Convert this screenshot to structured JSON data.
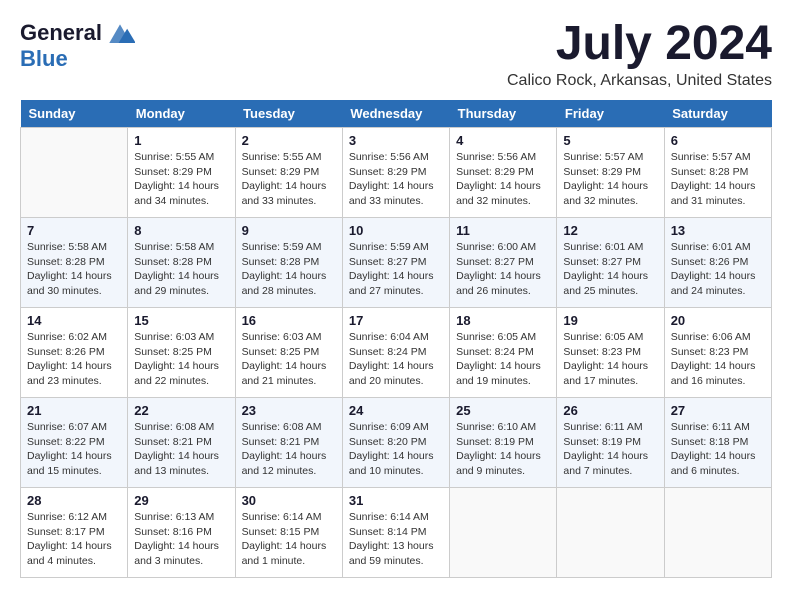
{
  "logo": {
    "general": "General",
    "blue": "Blue"
  },
  "title": "July 2024",
  "location": "Calico Rock, Arkansas, United States",
  "days_of_week": [
    "Sunday",
    "Monday",
    "Tuesday",
    "Wednesday",
    "Thursday",
    "Friday",
    "Saturday"
  ],
  "weeks": [
    [
      {
        "day": null
      },
      {
        "day": 1,
        "sunrise": "5:55 AM",
        "sunset": "8:29 PM",
        "daylight": "14 hours and 34 minutes."
      },
      {
        "day": 2,
        "sunrise": "5:55 AM",
        "sunset": "8:29 PM",
        "daylight": "14 hours and 33 minutes."
      },
      {
        "day": 3,
        "sunrise": "5:56 AM",
        "sunset": "8:29 PM",
        "daylight": "14 hours and 33 minutes."
      },
      {
        "day": 4,
        "sunrise": "5:56 AM",
        "sunset": "8:29 PM",
        "daylight": "14 hours and 32 minutes."
      },
      {
        "day": 5,
        "sunrise": "5:57 AM",
        "sunset": "8:29 PM",
        "daylight": "14 hours and 32 minutes."
      },
      {
        "day": 6,
        "sunrise": "5:57 AM",
        "sunset": "8:28 PM",
        "daylight": "14 hours and 31 minutes."
      }
    ],
    [
      {
        "day": 7,
        "sunrise": "5:58 AM",
        "sunset": "8:28 PM",
        "daylight": "14 hours and 30 minutes."
      },
      {
        "day": 8,
        "sunrise": "5:58 AM",
        "sunset": "8:28 PM",
        "daylight": "14 hours and 29 minutes."
      },
      {
        "day": 9,
        "sunrise": "5:59 AM",
        "sunset": "8:28 PM",
        "daylight": "14 hours and 28 minutes."
      },
      {
        "day": 10,
        "sunrise": "5:59 AM",
        "sunset": "8:27 PM",
        "daylight": "14 hours and 27 minutes."
      },
      {
        "day": 11,
        "sunrise": "6:00 AM",
        "sunset": "8:27 PM",
        "daylight": "14 hours and 26 minutes."
      },
      {
        "day": 12,
        "sunrise": "6:01 AM",
        "sunset": "8:27 PM",
        "daylight": "14 hours and 25 minutes."
      },
      {
        "day": 13,
        "sunrise": "6:01 AM",
        "sunset": "8:26 PM",
        "daylight": "14 hours and 24 minutes."
      }
    ],
    [
      {
        "day": 14,
        "sunrise": "6:02 AM",
        "sunset": "8:26 PM",
        "daylight": "14 hours and 23 minutes."
      },
      {
        "day": 15,
        "sunrise": "6:03 AM",
        "sunset": "8:25 PM",
        "daylight": "14 hours and 22 minutes."
      },
      {
        "day": 16,
        "sunrise": "6:03 AM",
        "sunset": "8:25 PM",
        "daylight": "14 hours and 21 minutes."
      },
      {
        "day": 17,
        "sunrise": "6:04 AM",
        "sunset": "8:24 PM",
        "daylight": "14 hours and 20 minutes."
      },
      {
        "day": 18,
        "sunrise": "6:05 AM",
        "sunset": "8:24 PM",
        "daylight": "14 hours and 19 minutes."
      },
      {
        "day": 19,
        "sunrise": "6:05 AM",
        "sunset": "8:23 PM",
        "daylight": "14 hours and 17 minutes."
      },
      {
        "day": 20,
        "sunrise": "6:06 AM",
        "sunset": "8:23 PM",
        "daylight": "14 hours and 16 minutes."
      }
    ],
    [
      {
        "day": 21,
        "sunrise": "6:07 AM",
        "sunset": "8:22 PM",
        "daylight": "14 hours and 15 minutes."
      },
      {
        "day": 22,
        "sunrise": "6:08 AM",
        "sunset": "8:21 PM",
        "daylight": "14 hours and 13 minutes."
      },
      {
        "day": 23,
        "sunrise": "6:08 AM",
        "sunset": "8:21 PM",
        "daylight": "14 hours and 12 minutes."
      },
      {
        "day": 24,
        "sunrise": "6:09 AM",
        "sunset": "8:20 PM",
        "daylight": "14 hours and 10 minutes."
      },
      {
        "day": 25,
        "sunrise": "6:10 AM",
        "sunset": "8:19 PM",
        "daylight": "14 hours and 9 minutes."
      },
      {
        "day": 26,
        "sunrise": "6:11 AM",
        "sunset": "8:19 PM",
        "daylight": "14 hours and 7 minutes."
      },
      {
        "day": 27,
        "sunrise": "6:11 AM",
        "sunset": "8:18 PM",
        "daylight": "14 hours and 6 minutes."
      }
    ],
    [
      {
        "day": 28,
        "sunrise": "6:12 AM",
        "sunset": "8:17 PM",
        "daylight": "14 hours and 4 minutes."
      },
      {
        "day": 29,
        "sunrise": "6:13 AM",
        "sunset": "8:16 PM",
        "daylight": "14 hours and 3 minutes."
      },
      {
        "day": 30,
        "sunrise": "6:14 AM",
        "sunset": "8:15 PM",
        "daylight": "14 hours and 1 minute."
      },
      {
        "day": 31,
        "sunrise": "6:14 AM",
        "sunset": "8:14 PM",
        "daylight": "13 hours and 59 minutes."
      },
      {
        "day": null
      },
      {
        "day": null
      },
      {
        "day": null
      }
    ]
  ]
}
